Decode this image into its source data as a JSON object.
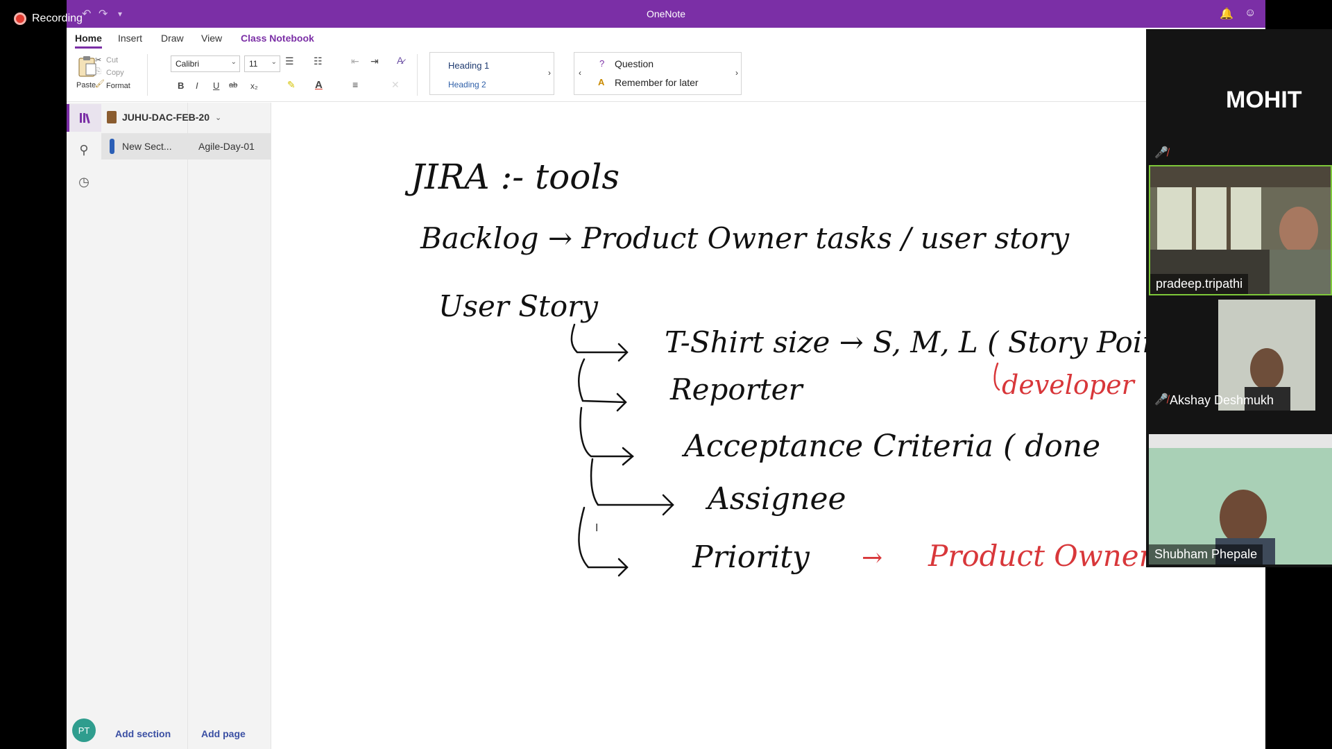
{
  "recording": {
    "label": "Recording"
  },
  "app": {
    "title": "OneNote"
  },
  "tabs": [
    "Home",
    "Insert",
    "Draw",
    "View",
    "Class Notebook"
  ],
  "ribbon": {
    "paste": "Paste",
    "cut": "Cut",
    "copy": "Copy",
    "format": "Format",
    "font": "Calibri",
    "size": "11",
    "bold": "B",
    "italic": "I",
    "underline": "U",
    "strike": "ab",
    "subscript": "x₂",
    "styles": [
      "Heading 1",
      "Heading 2"
    ],
    "tags": [
      "Question",
      "Remember for later"
    ]
  },
  "notebook": {
    "name": "JUHU-DAC-FEB-20",
    "section": "New Sect...",
    "page": "Agile-Day-01",
    "add_section": "Add section",
    "add_page": "Add page",
    "user_initials": "PT"
  },
  "participants": {
    "speaker": "MOHIT",
    "tiles": [
      "pradeep.tripathi",
      "Akshay Deshmukh",
      "Shubham Phepale"
    ]
  },
  "note": {
    "line1": "JIRA :- tools",
    "line2": "Backlog → Product Owner tasks / user story",
    "line3": "User Story",
    "item1": "T-Shirt size → S, M, L ( Story Point",
    "item1_sub": "developer",
    "item2": "Reporter",
    "item3": "Acceptance Criteria ( done",
    "item4": "Assignee",
    "item5": "Priority",
    "item5_arrow": "→",
    "item5_sub": "Product Owner"
  },
  "colors": {
    "accent": "#7b2fa6",
    "ink": "#111111",
    "red_ink": "#d8373a"
  }
}
